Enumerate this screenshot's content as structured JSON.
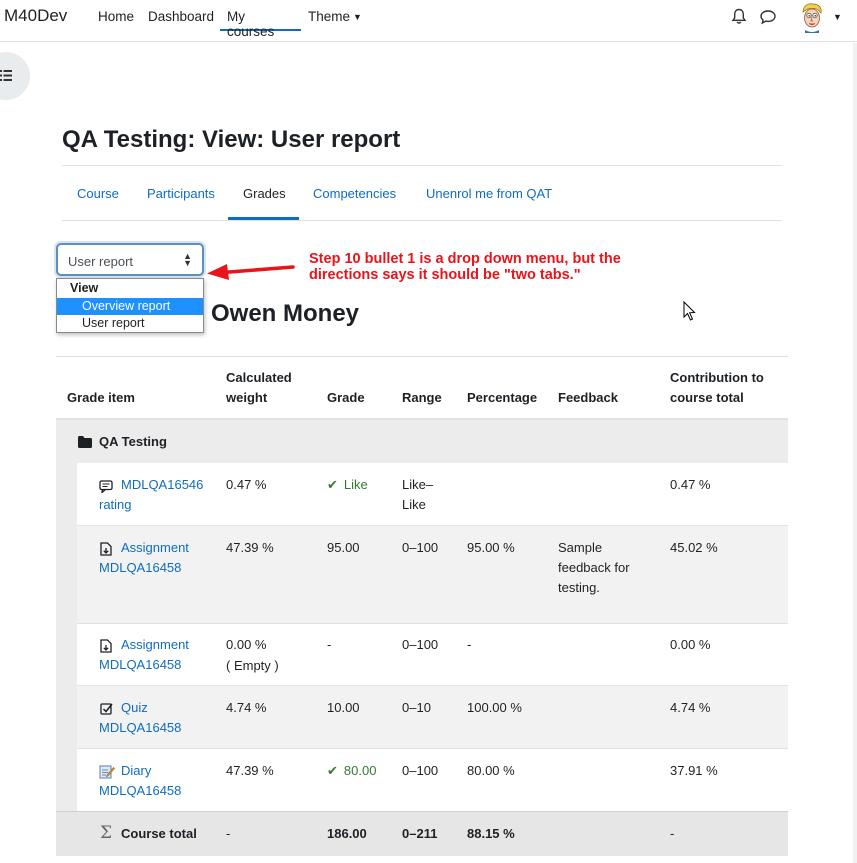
{
  "navbar": {
    "brand": "M40Dev",
    "links": [
      "Home",
      "Dashboard",
      "My courses",
      "Theme"
    ],
    "active": "My courses",
    "icons": [
      "bell-icon",
      "chat-icon",
      "avatar",
      "chevron-down-icon"
    ]
  },
  "page": {
    "title": "QA Testing: View: User report",
    "user_name": "Owen Money"
  },
  "tabs": [
    "Course",
    "Participants",
    "Grades",
    "Competencies",
    "Unenrol me from QAT"
  ],
  "active_tab": "Grades",
  "report_select": {
    "value": "User report",
    "group": "View",
    "options": [
      "Overview report",
      "User report"
    ],
    "highlighted": "Overview report"
  },
  "annotation": {
    "text": "Step 10 bullet 1 is a drop down menu, but the directions says it should be \"two tabs.\"",
    "color": "#e8141a"
  },
  "table": {
    "headers": {
      "item": "Grade item",
      "weight": "Calculated weight",
      "grade": "Grade",
      "range": "Range",
      "percentage": "Percentage",
      "feedback": "Feedback",
      "contribution": "Contribution to course total"
    },
    "category": "QA Testing",
    "rows": [
      {
        "icon": "forum-icon",
        "item": "MDLQA16546 rating",
        "weight": "0.47 %",
        "grade": "Like",
        "grade_check": true,
        "range": "Like–Like",
        "percentage": "",
        "feedback": "",
        "contribution": "0.47 %"
      },
      {
        "icon": "assignment-icon",
        "item": "Assignment MDLQA16458",
        "weight": "47.39 %",
        "grade": "95.00",
        "grade_check": false,
        "range": "0–100",
        "percentage": "95.00 %",
        "feedback": "Sample feedback for testing.",
        "contribution": "45.02 %"
      },
      {
        "icon": "assignment-icon",
        "item": "Assignment MDLQA16458",
        "weight": "0.00 %",
        "weight_note": "( Empty )",
        "grade": "-",
        "grade_check": false,
        "range": "0–100",
        "percentage": "-",
        "feedback": "",
        "contribution": "0.00 %"
      },
      {
        "icon": "quiz-icon",
        "item": "Quiz MDLQA16458",
        "weight": "4.74 %",
        "grade": "10.00",
        "grade_check": false,
        "range": "0–10",
        "percentage": "100.00 %",
        "feedback": "",
        "contribution": "4.74 %"
      },
      {
        "icon": "diary-icon",
        "item": "Diary MDLQA16458",
        "weight": "47.39 %",
        "grade": "80.00",
        "grade_check": true,
        "range": "0–100",
        "percentage": "80.00 %",
        "feedback": "",
        "contribution": "37.91 %"
      }
    ],
    "total": {
      "icon": "sigma-icon",
      "label": "Course total",
      "weight": "-",
      "grade": "186.00",
      "range": "0–211",
      "percentage": "88.15 %",
      "contribution": "-"
    }
  },
  "colors": {
    "link": "#0f6cbf",
    "success": "#357a32",
    "annotation": "#e8141a",
    "highlight": "#1e90ff"
  }
}
